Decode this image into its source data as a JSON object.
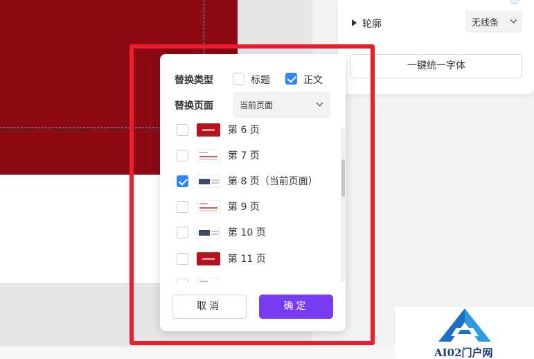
{
  "right_panel": {
    "outline_label": "轮廓",
    "line_style_value": "无线条",
    "unify_font_button": "一键统一字体"
  },
  "dialog": {
    "replace_type_label": "替换类型",
    "options": [
      {
        "label": "标题",
        "checked": false
      },
      {
        "label": "正文",
        "checked": true
      }
    ],
    "replace_page_label": "替换页面",
    "page_scope_value": "当前页面",
    "pages": [
      {
        "label": "第 6 页",
        "checked": false,
        "thumb": "red"
      },
      {
        "label": "第 7 页",
        "checked": false,
        "thumb": "white"
      },
      {
        "label": "第 8 页（当前页面）",
        "checked": true,
        "thumb": "photo"
      },
      {
        "label": "第 9 页",
        "checked": false,
        "thumb": "white"
      },
      {
        "label": "第 10 页",
        "checked": false,
        "thumb": "photo"
      },
      {
        "label": "第 11 页",
        "checked": false,
        "thumb": "red"
      }
    ],
    "cancel_label": "取消",
    "confirm_label": "确定"
  },
  "colors": {
    "slide_red": "#8b0a13",
    "highlight_red": "#ec1c2a",
    "confirm_purple": "#7a3cf0",
    "checkbox_blue": "#2e86f5"
  },
  "watermark": {
    "text": "AI02门户网"
  }
}
